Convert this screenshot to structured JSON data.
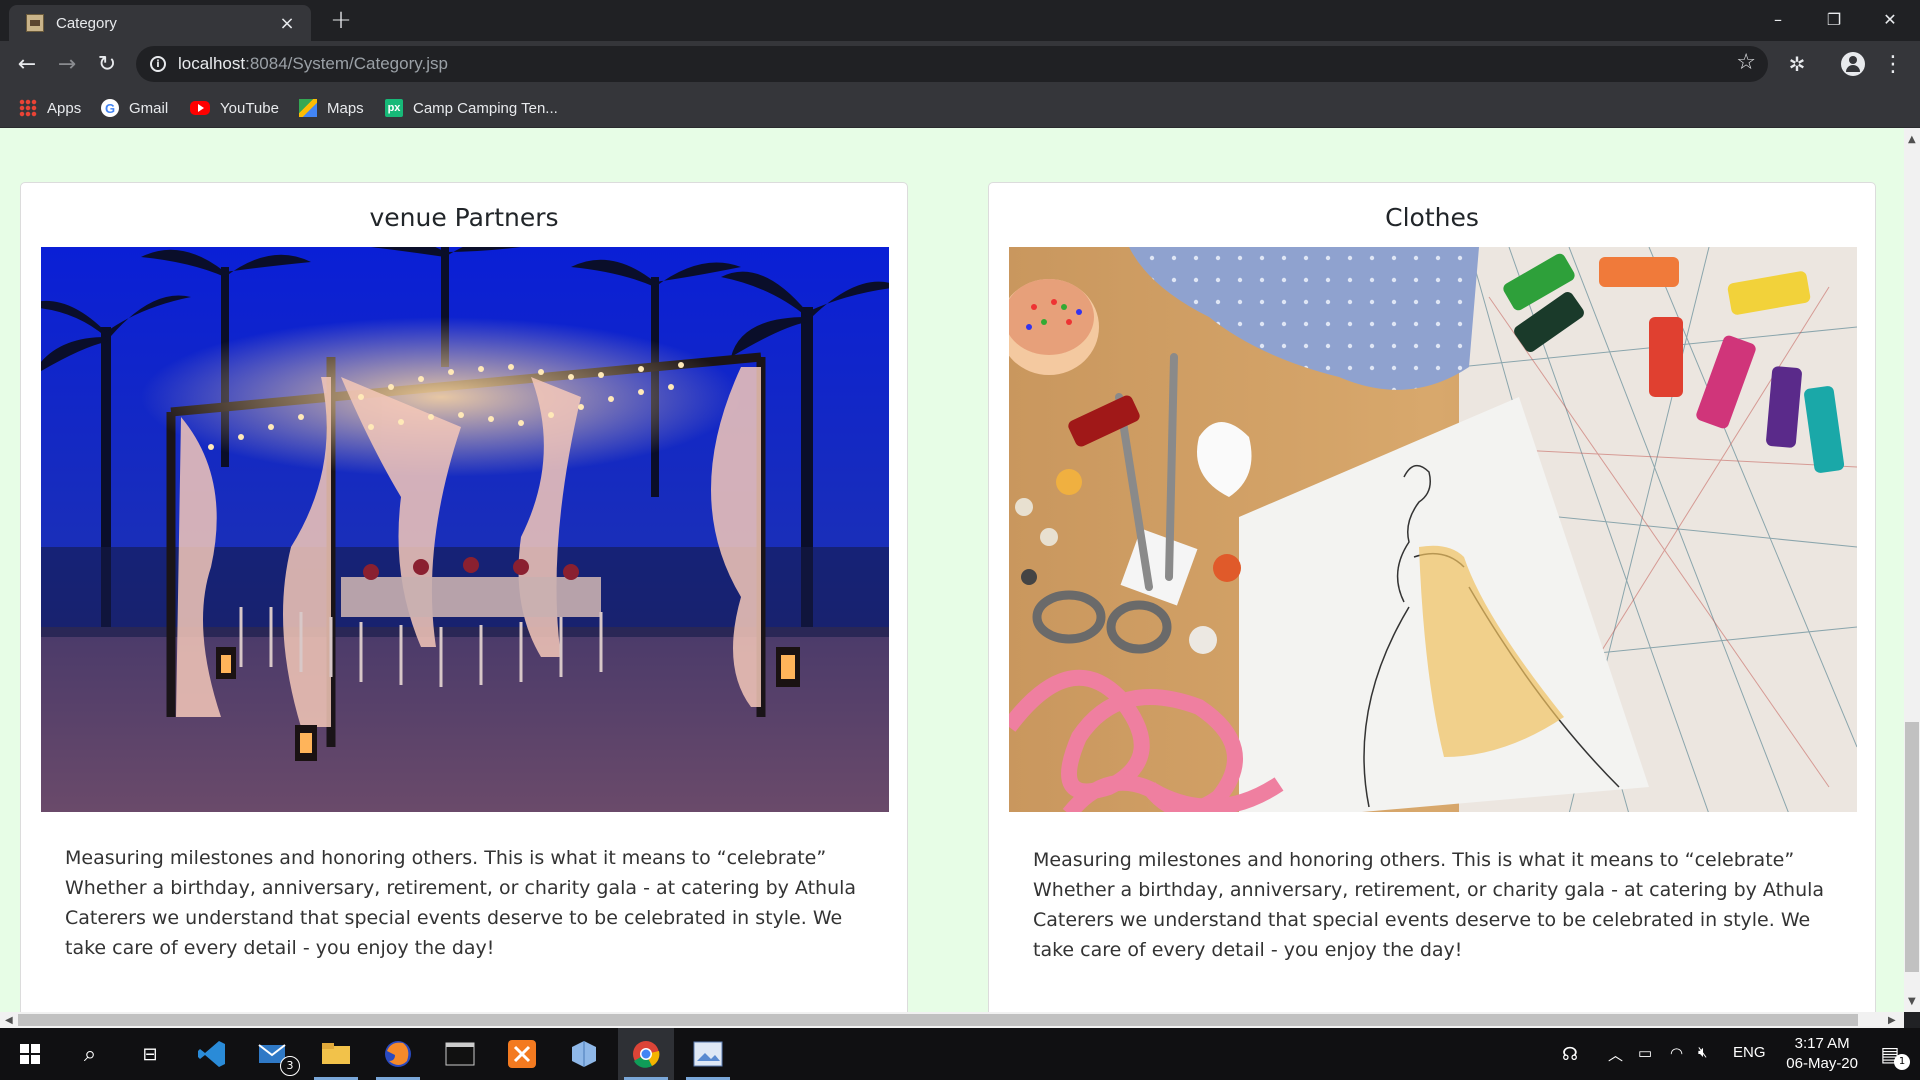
{
  "browser": {
    "tab_title": "Category",
    "tab_close": "×",
    "new_tab": "+",
    "url_host": "localhost",
    "url_rest": ":8084/System/Category.jsp",
    "window_controls": {
      "minimize": "–",
      "restore": "❐",
      "close": "✕"
    }
  },
  "bookmarks": [
    {
      "label": "Apps",
      "icon": "apps-icon"
    },
    {
      "label": "Gmail",
      "icon": "gmail-icon"
    },
    {
      "label": "YouTube",
      "icon": "youtube-icon"
    },
    {
      "label": "Maps",
      "icon": "maps-icon"
    },
    {
      "label": "Camp Camping Ten...",
      "icon": "px-icon"
    }
  ],
  "cards": [
    {
      "title": "venue Partners",
      "image": "night-beach-tent-dinner",
      "text": "Measuring milestones and honoring others. This is what it means to “celebrate” Whether a birthday, anniversary, retirement, or charity gala - at catering by Athula Caterers we understand that special events deserve to be celebrated in style. We take care of every detail - you enjoy the day!"
    },
    {
      "title": "Clothes",
      "image": "sewing-tools-sketch",
      "text": "Measuring milestones and honoring others. This is what it means to “celebrate” Whether a birthday, anniversary, retirement, or charity gala - at catering by Athula Caterers we understand that special events deserve to be celebrated in style. We take care of every detail - you enjoy the day!"
    }
  ],
  "taskbar": {
    "time": "3:17 AM",
    "date": "06-May-20",
    "language": "ENG",
    "mail_badge": "3",
    "notification_badge": "1"
  },
  "colors": {
    "page_bg": "#e7fde6",
    "chrome_dark": "#202124",
    "chrome_toolbar": "#35363a"
  }
}
